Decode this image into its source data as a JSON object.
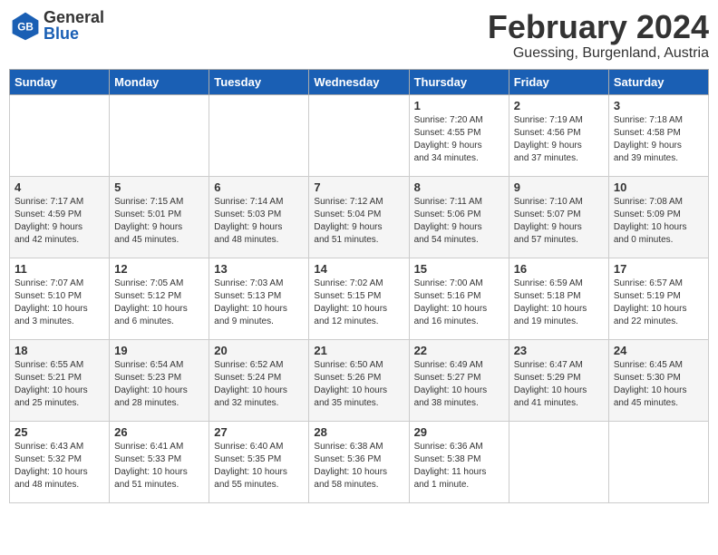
{
  "header": {
    "logo_general": "General",
    "logo_blue": "Blue",
    "month": "February 2024",
    "location": "Guessing, Burgenland, Austria"
  },
  "weekdays": [
    "Sunday",
    "Monday",
    "Tuesday",
    "Wednesday",
    "Thursday",
    "Friday",
    "Saturday"
  ],
  "weeks": [
    [
      {
        "day": "",
        "info": ""
      },
      {
        "day": "",
        "info": ""
      },
      {
        "day": "",
        "info": ""
      },
      {
        "day": "",
        "info": ""
      },
      {
        "day": "1",
        "info": "Sunrise: 7:20 AM\nSunset: 4:55 PM\nDaylight: 9 hours\nand 34 minutes."
      },
      {
        "day": "2",
        "info": "Sunrise: 7:19 AM\nSunset: 4:56 PM\nDaylight: 9 hours\nand 37 minutes."
      },
      {
        "day": "3",
        "info": "Sunrise: 7:18 AM\nSunset: 4:58 PM\nDaylight: 9 hours\nand 39 minutes."
      }
    ],
    [
      {
        "day": "4",
        "info": "Sunrise: 7:17 AM\nSunset: 4:59 PM\nDaylight: 9 hours\nand 42 minutes."
      },
      {
        "day": "5",
        "info": "Sunrise: 7:15 AM\nSunset: 5:01 PM\nDaylight: 9 hours\nand 45 minutes."
      },
      {
        "day": "6",
        "info": "Sunrise: 7:14 AM\nSunset: 5:03 PM\nDaylight: 9 hours\nand 48 minutes."
      },
      {
        "day": "7",
        "info": "Sunrise: 7:12 AM\nSunset: 5:04 PM\nDaylight: 9 hours\nand 51 minutes."
      },
      {
        "day": "8",
        "info": "Sunrise: 7:11 AM\nSunset: 5:06 PM\nDaylight: 9 hours\nand 54 minutes."
      },
      {
        "day": "9",
        "info": "Sunrise: 7:10 AM\nSunset: 5:07 PM\nDaylight: 9 hours\nand 57 minutes."
      },
      {
        "day": "10",
        "info": "Sunrise: 7:08 AM\nSunset: 5:09 PM\nDaylight: 10 hours\nand 0 minutes."
      }
    ],
    [
      {
        "day": "11",
        "info": "Sunrise: 7:07 AM\nSunset: 5:10 PM\nDaylight: 10 hours\nand 3 minutes."
      },
      {
        "day": "12",
        "info": "Sunrise: 7:05 AM\nSunset: 5:12 PM\nDaylight: 10 hours\nand 6 minutes."
      },
      {
        "day": "13",
        "info": "Sunrise: 7:03 AM\nSunset: 5:13 PM\nDaylight: 10 hours\nand 9 minutes."
      },
      {
        "day": "14",
        "info": "Sunrise: 7:02 AM\nSunset: 5:15 PM\nDaylight: 10 hours\nand 12 minutes."
      },
      {
        "day": "15",
        "info": "Sunrise: 7:00 AM\nSunset: 5:16 PM\nDaylight: 10 hours\nand 16 minutes."
      },
      {
        "day": "16",
        "info": "Sunrise: 6:59 AM\nSunset: 5:18 PM\nDaylight: 10 hours\nand 19 minutes."
      },
      {
        "day": "17",
        "info": "Sunrise: 6:57 AM\nSunset: 5:19 PM\nDaylight: 10 hours\nand 22 minutes."
      }
    ],
    [
      {
        "day": "18",
        "info": "Sunrise: 6:55 AM\nSunset: 5:21 PM\nDaylight: 10 hours\nand 25 minutes."
      },
      {
        "day": "19",
        "info": "Sunrise: 6:54 AM\nSunset: 5:23 PM\nDaylight: 10 hours\nand 28 minutes."
      },
      {
        "day": "20",
        "info": "Sunrise: 6:52 AM\nSunset: 5:24 PM\nDaylight: 10 hours\nand 32 minutes."
      },
      {
        "day": "21",
        "info": "Sunrise: 6:50 AM\nSunset: 5:26 PM\nDaylight: 10 hours\nand 35 minutes."
      },
      {
        "day": "22",
        "info": "Sunrise: 6:49 AM\nSunset: 5:27 PM\nDaylight: 10 hours\nand 38 minutes."
      },
      {
        "day": "23",
        "info": "Sunrise: 6:47 AM\nSunset: 5:29 PM\nDaylight: 10 hours\nand 41 minutes."
      },
      {
        "day": "24",
        "info": "Sunrise: 6:45 AM\nSunset: 5:30 PM\nDaylight: 10 hours\nand 45 minutes."
      }
    ],
    [
      {
        "day": "25",
        "info": "Sunrise: 6:43 AM\nSunset: 5:32 PM\nDaylight: 10 hours\nand 48 minutes."
      },
      {
        "day": "26",
        "info": "Sunrise: 6:41 AM\nSunset: 5:33 PM\nDaylight: 10 hours\nand 51 minutes."
      },
      {
        "day": "27",
        "info": "Sunrise: 6:40 AM\nSunset: 5:35 PM\nDaylight: 10 hours\nand 55 minutes."
      },
      {
        "day": "28",
        "info": "Sunrise: 6:38 AM\nSunset: 5:36 PM\nDaylight: 10 hours\nand 58 minutes."
      },
      {
        "day": "29",
        "info": "Sunrise: 6:36 AM\nSunset: 5:38 PM\nDaylight: 11 hours\nand 1 minute."
      },
      {
        "day": "",
        "info": ""
      },
      {
        "day": "",
        "info": ""
      }
    ]
  ]
}
